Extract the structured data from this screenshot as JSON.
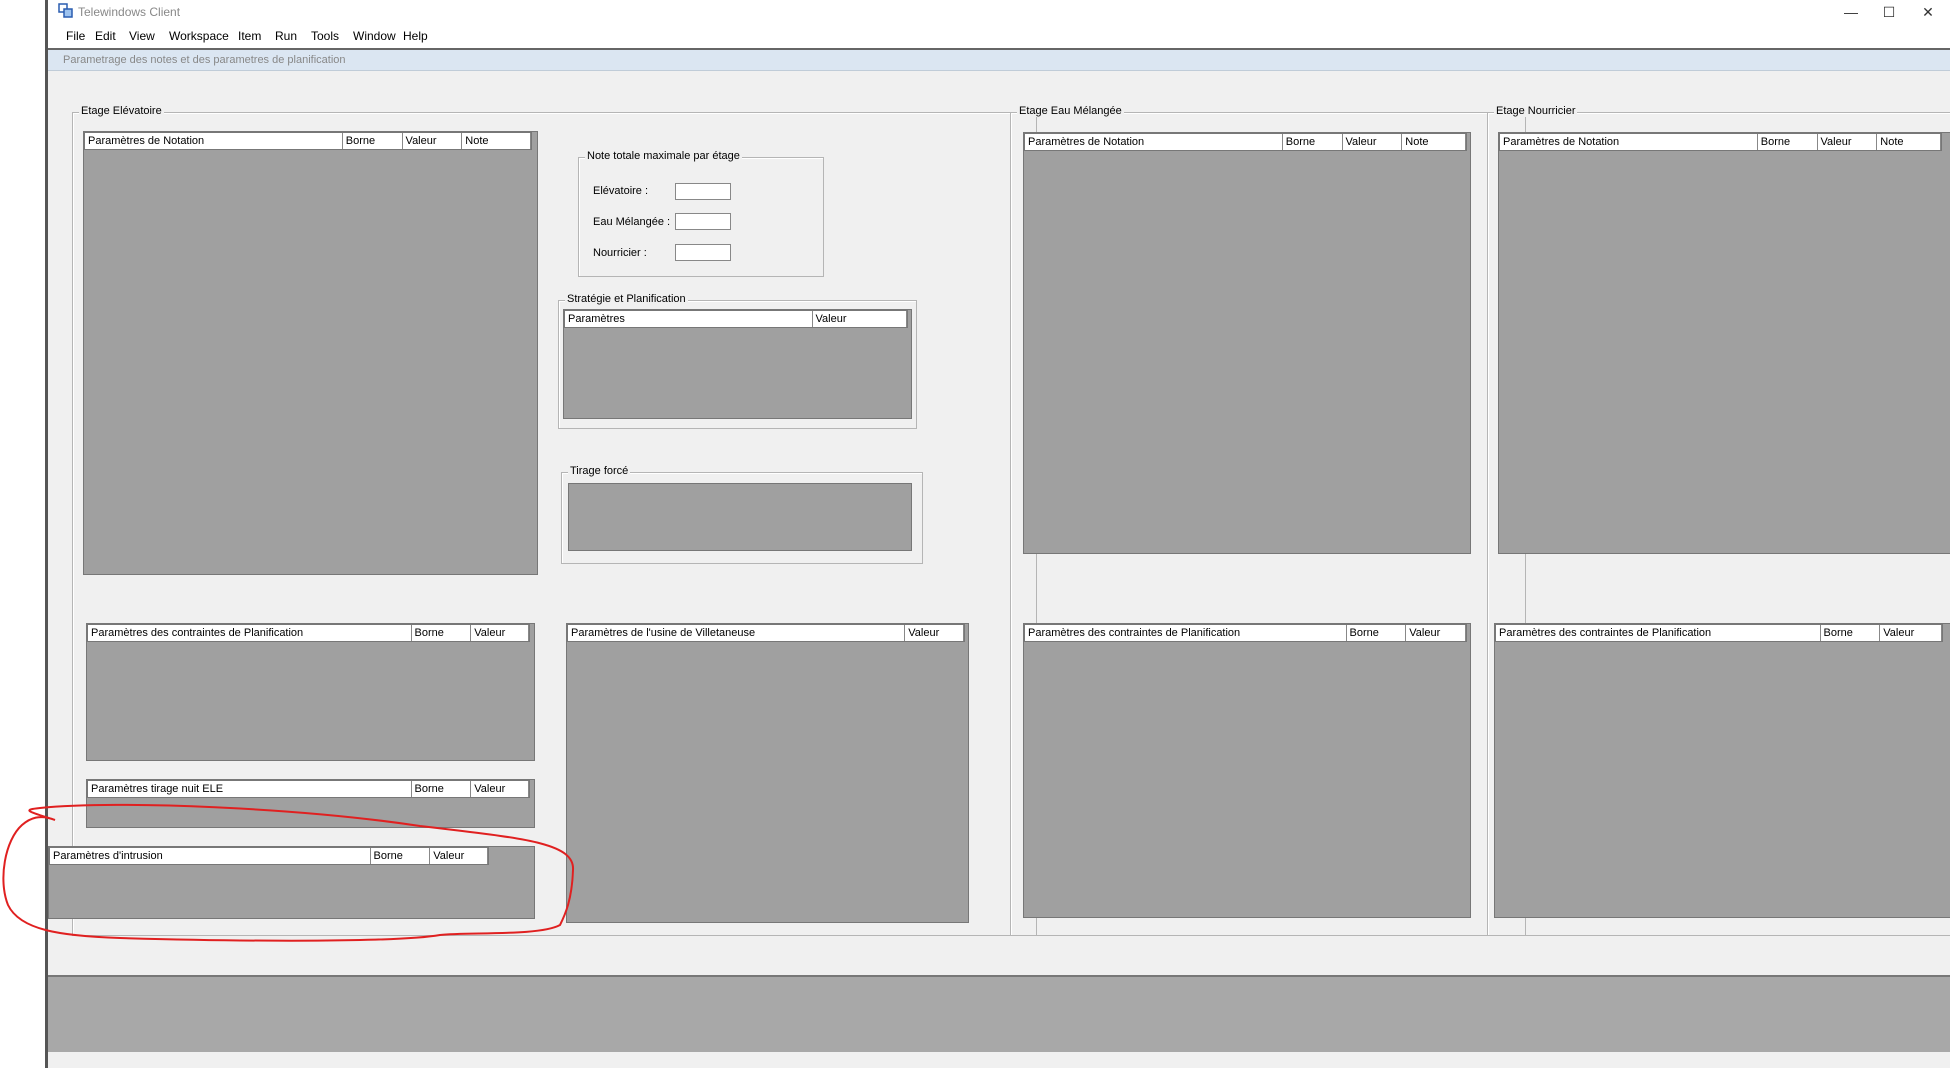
{
  "window": {
    "title": "Telewindows Client",
    "minimize": "—",
    "maximize": "☐",
    "close": "✕"
  },
  "menu": [
    "File",
    "Edit",
    "View",
    "Workspace",
    "Item",
    "Run",
    "Tools",
    "Window",
    "Help"
  ],
  "doc_tab": {
    "label": "Parametrage des notes et des parametres de planification"
  },
  "elevatoire": {
    "legend": "Etage Elévatoire",
    "notation_headers": [
      "Paramètres de Notation",
      "Borne",
      "Valeur",
      "Note"
    ],
    "contraintes_headers": [
      "Paramètres des contraintes de Planification",
      "Borne",
      "Valeur"
    ],
    "tirage_nuit_headers": [
      "Paramètres tirage nuit ELE",
      "Borne",
      "Valeur"
    ],
    "intrusion_headers": [
      "Paramètres d'intrusion",
      "Borne",
      "Valeur"
    ]
  },
  "note_totale": {
    "legend": "Note totale maximale par étage",
    "fields": [
      {
        "label": "Elévatoire :",
        "value": ""
      },
      {
        "label": "Eau Mélangée :",
        "value": ""
      },
      {
        "label": "Nourricier :",
        "value": ""
      }
    ]
  },
  "strategie": {
    "legend": "Stratégie et Planification",
    "headers": [
      "Paramètres",
      "Valeur"
    ]
  },
  "tirage_force": {
    "legend": "Tirage forcé"
  },
  "usine": {
    "headers": [
      "Paramètres de l'usine de Villetaneuse",
      "Valeur"
    ]
  },
  "eau_melangee": {
    "legend": "Etage Eau Mélangée",
    "notation_headers": [
      "Paramètres de Notation",
      "Borne",
      "Valeur",
      "Note"
    ],
    "contraintes_headers": [
      "Paramètres des contraintes de Planification",
      "Borne",
      "Valeur"
    ]
  },
  "nourricier": {
    "legend": "Etage Nourricier",
    "notation_headers": [
      "Paramètres de Notation",
      "Borne",
      "Valeur",
      "Note"
    ],
    "contraintes_headers": [
      "Paramètres des contraintes de Planification",
      "Borne",
      "Valeur"
    ]
  },
  "colors": {
    "table_bg": "#a0a0a0",
    "panel_bg": "#f0f0f0",
    "annotation": "#e02020"
  }
}
